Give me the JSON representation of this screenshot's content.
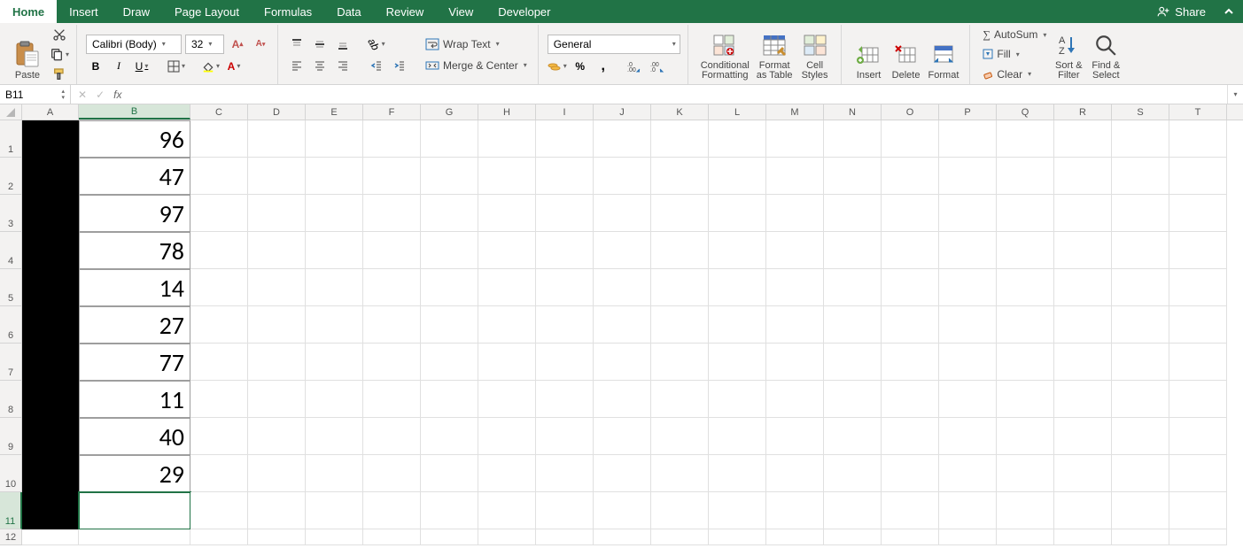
{
  "menu": {
    "tabs": [
      "Home",
      "Insert",
      "Draw",
      "Page Layout",
      "Formulas",
      "Data",
      "Review",
      "View",
      "Developer"
    ],
    "active": "Home",
    "share": "Share"
  },
  "ribbon": {
    "clipboard": {
      "paste": "Paste"
    },
    "font": {
      "name": "Calibri (Body)",
      "size": "32"
    },
    "alignment": {
      "wrap": "Wrap Text",
      "merge": "Merge & Center"
    },
    "number": {
      "format": "General"
    },
    "styles": {
      "cond": "Conditional\nFormatting",
      "table": "Format\nas Table",
      "cell": "Cell\nStyles"
    },
    "cells": {
      "insert": "Insert",
      "delete": "Delete",
      "format": "Format"
    },
    "editing": {
      "autosum": "AutoSum",
      "fill": "Fill",
      "clear": "Clear",
      "sort": "Sort &\nFilter",
      "find": "Find &\nSelect"
    }
  },
  "namebox": "B11",
  "formula": "",
  "columns": [
    "A",
    "B",
    "C",
    "D",
    "E",
    "F",
    "G",
    "H",
    "I",
    "J",
    "K",
    "L",
    "M",
    "N",
    "O",
    "P",
    "Q",
    "R",
    "S",
    "T"
  ],
  "selectedCol": "B",
  "selectedRow": 11,
  "rows": [
    {
      "n": 1,
      "b": "96"
    },
    {
      "n": 2,
      "b": "47"
    },
    {
      "n": 3,
      "b": "97"
    },
    {
      "n": 4,
      "b": "78"
    },
    {
      "n": 5,
      "b": "14"
    },
    {
      "n": 6,
      "b": "27"
    },
    {
      "n": 7,
      "b": "77"
    },
    {
      "n": 8,
      "b": "11"
    },
    {
      "n": 9,
      "b": "40"
    },
    {
      "n": 10,
      "b": "29"
    },
    {
      "n": 11,
      "b": ""
    },
    {
      "n": 12,
      "b": ""
    }
  ]
}
